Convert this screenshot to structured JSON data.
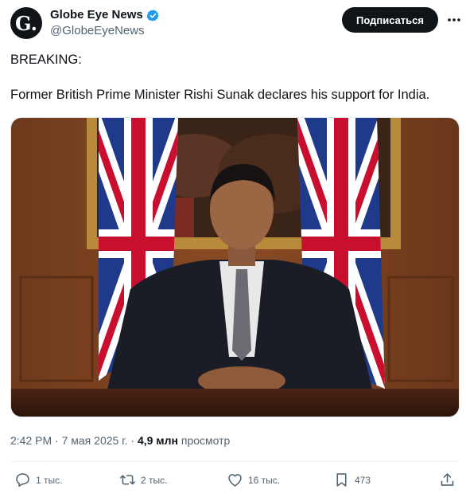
{
  "account": {
    "avatar_letter": "G.",
    "display_name": "Globe Eye News",
    "handle": "@GlobeEyeNews",
    "verified": true
  },
  "header": {
    "subscribe_label": "Подписаться"
  },
  "tweet": {
    "line1": "BREAKING:",
    "line2": "Former British Prime Minister Rishi Sunak declares his support for India."
  },
  "meta": {
    "time": "2:42 PM",
    "date": "7 мая 2025 г.",
    "dot": "·",
    "separator": "·",
    "views_count": "4,9 млн",
    "views_label": "просмотр"
  },
  "actions": {
    "reply_count": "1 тыс.",
    "retweet_count": "2 тыс.",
    "like_count": "16 тыс.",
    "bookmark_count": "473"
  },
  "colors": {
    "text_primary": "#0f1419",
    "text_secondary": "#536471",
    "verified_blue": "#1d9bf0",
    "button_bg": "#0f1419",
    "divider": "#eff3f4"
  },
  "icons": [
    "verified-badge-icon",
    "more-icon",
    "reply-icon",
    "retweet-icon",
    "like-icon",
    "bookmark-icon",
    "share-icon"
  ]
}
